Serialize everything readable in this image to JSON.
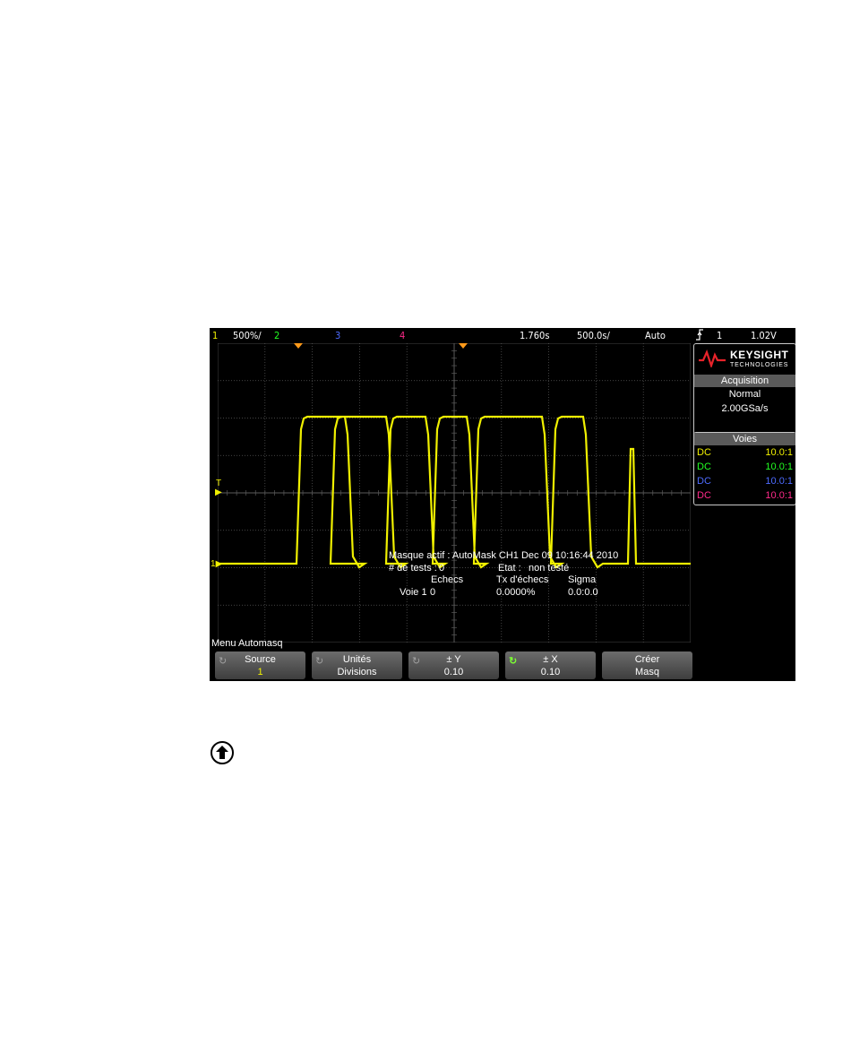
{
  "status_bar": {
    "ch1_num": "1",
    "ch1_scale": "500%/",
    "ch2_num": "2",
    "ch3_num": "3",
    "ch4_num": "4",
    "time_delay": "1.760s",
    "time_scale": "500.0s/",
    "trigger_mode": "Auto",
    "trigger_slope_icon": "rising-edge-icon",
    "trigger_source": "1",
    "trigger_level": "1.02V"
  },
  "colors": {
    "ch1": "#f0f000",
    "ch2": "#22ff22",
    "ch3": "#4d6bff",
    "ch4": "#ff2a8a",
    "grid": "#5a5a5a",
    "softkey_knob_active": "#7cff33"
  },
  "brand": {
    "name": "KEYSIGHT",
    "sub": "TECHNOLOGIES"
  },
  "acquisition": {
    "header": "Acquisition",
    "mode": "Normal",
    "rate": "2.00GSa/s"
  },
  "channels": {
    "header": "Voies",
    "rows": [
      {
        "coupling": "DC",
        "probe": "10.0:1"
      },
      {
        "coupling": "DC",
        "probe": "10.0:1"
      },
      {
        "coupling": "DC",
        "probe": "10.0:1"
      },
      {
        "coupling": "DC",
        "probe": "10.0:1"
      }
    ]
  },
  "markers": {
    "trigger_level": "T",
    "ch1_ground": "1"
  },
  "mask_info": {
    "active": "Masque actif : AutoMask CH1 Dec 09 10:16:44 2010",
    "tests_label": "# de tests :",
    "tests_value": "0",
    "state_label": "Etat :",
    "state_value": "non testé",
    "col_failures": "Echecs",
    "col_fail_rate": "Tx d'échecs",
    "col_sigma": "Sigma",
    "row_label": "Voie 1",
    "row_failures": "0",
    "row_fail_rate": "0.0000%",
    "row_sigma": "0.0:0.0"
  },
  "menu": {
    "title": "Menu Automasq",
    "softkeys": [
      {
        "top": "Source",
        "bottom": "1"
      },
      {
        "top": "Unités",
        "bottom": "Divisions"
      },
      {
        "top": "± Y",
        "bottom": "0.10"
      },
      {
        "top": "± X",
        "bottom": "0.10"
      },
      {
        "top": "Créer",
        "bottom": "Masq"
      }
    ]
  },
  "note_icon": "up-arrow-circle-icon"
}
